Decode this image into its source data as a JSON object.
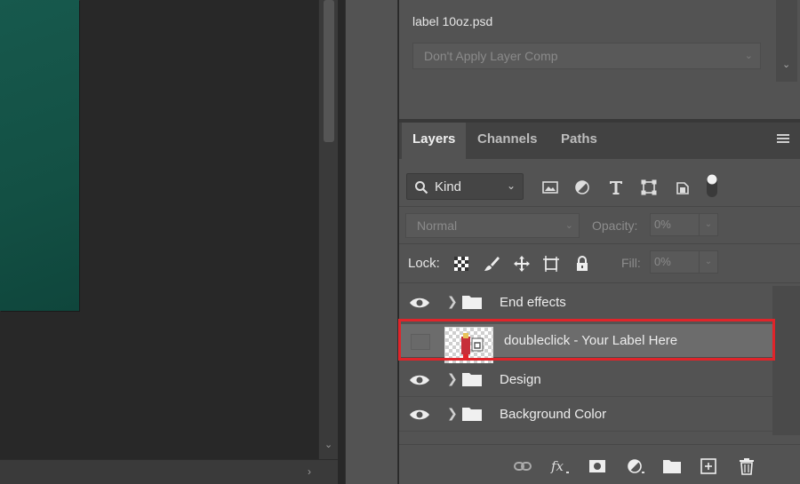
{
  "comps_panel": {
    "doc_name": "label 10oz.psd",
    "comp_select": "Don't Apply Layer Comp"
  },
  "layers_panel": {
    "tabs": [
      {
        "label": "Layers",
        "active": true
      },
      {
        "label": "Channels",
        "active": false
      },
      {
        "label": "Paths",
        "active": false
      }
    ],
    "filter": {
      "kind_label": "Kind"
    },
    "blend_mode": "Normal",
    "opacity_label": "Opacity:",
    "opacity_value": "0%",
    "lock_label": "Lock:",
    "fill_label": "Fill:",
    "fill_value": "0%",
    "layers": [
      {
        "name": "End effects",
        "type": "group",
        "visible": true,
        "selected": false
      },
      {
        "name": "doubleclick - Your Label Here",
        "type": "smart-object",
        "visible": false,
        "selected": true
      },
      {
        "name": "Design",
        "type": "group",
        "visible": true,
        "selected": false
      },
      {
        "name": "Background Color",
        "type": "group",
        "visible": true,
        "selected": false
      }
    ]
  },
  "colors": {
    "document_fill": "#135044",
    "highlight": "#e0242a",
    "panel_bg": "#535353"
  },
  "icons": [
    "search-icon",
    "image-filter-icon",
    "adjustment-filter-icon",
    "type-filter-icon",
    "shape-filter-icon",
    "smart-object-filter-icon",
    "filter-toggle-icon",
    "lock-transparent-icon",
    "lock-paint-icon",
    "lock-move-icon",
    "lock-artboard-icon",
    "lock-all-icon",
    "eye-icon",
    "folder-icon",
    "link-icon",
    "fx-icon",
    "mask-icon",
    "adjustment-icon",
    "new-group-icon",
    "new-layer-icon",
    "trash-icon"
  ]
}
